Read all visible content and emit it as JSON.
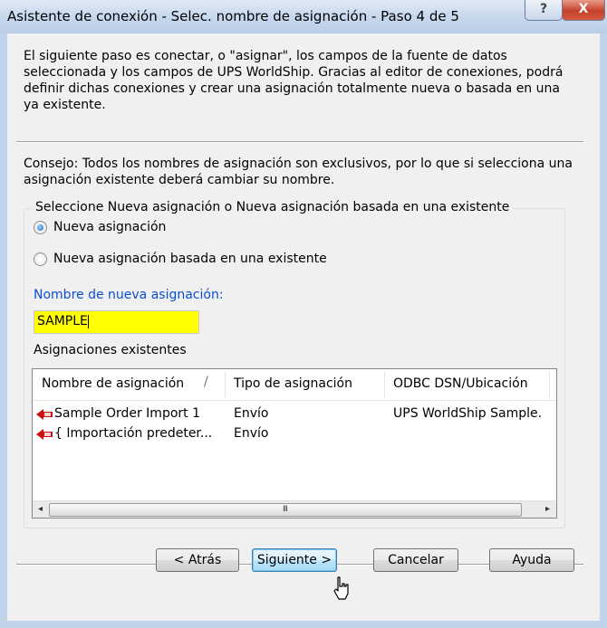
{
  "window": {
    "title": "Asistente de conexión - Selec. nombre de asignación - Paso 4 de 5",
    "help_button": "?",
    "close_button": "X"
  },
  "intro_text": "El siguiente paso es conectar, o \"asignar\", los campos de la fuente de datos seleccionada y los campos de UPS WorldShip. Gracias al editor de conexiones, podrá definir dichas conexiones y crear una asignación totalmente nueva o basada en una ya existente.",
  "tip_text": "Consejo: Todos los nombres de asignación son exclusivos, por lo que si selecciona una asignación existente deberá cambiar su nombre.",
  "group": {
    "legend": "Seleccione Nueva asignación o Nueva asignación basada en una existente",
    "option_new": "Nueva asignación",
    "option_based": "Nueva asignación basada en una existente",
    "selected": "option_new",
    "name_label": "Nombre de nueva asignación:",
    "name_value": "SAMPLE",
    "existing_label": "Asignaciones existentes"
  },
  "table": {
    "columns": [
      "Nombre de asignación",
      "Tipo de asignación",
      "ODBC DSN/Ubicación"
    ],
    "sort_indicator": "/",
    "rows": [
      {
        "name": "Sample Order Import 1",
        "type": "Envío",
        "location": "UPS WorldShip Sample."
      },
      {
        "name": "{ Importación predeter...",
        "type": "Envío",
        "location": ""
      }
    ],
    "scroll_left_icon": "◂",
    "scroll_right_icon": "▸",
    "scroll_grip": "III"
  },
  "buttons": {
    "back": "< Atrás",
    "next": "Siguiente >",
    "cancel": "Cancelar",
    "help": "Ayuda"
  },
  "colors": {
    "input_highlight": "#ffff00",
    "label_blue": "#0a4fd6",
    "row_icon": "#cc1111"
  },
  "icons": {
    "row_icon": "map-arrow-icon",
    "cursor": "mouse-pointer-icon"
  }
}
